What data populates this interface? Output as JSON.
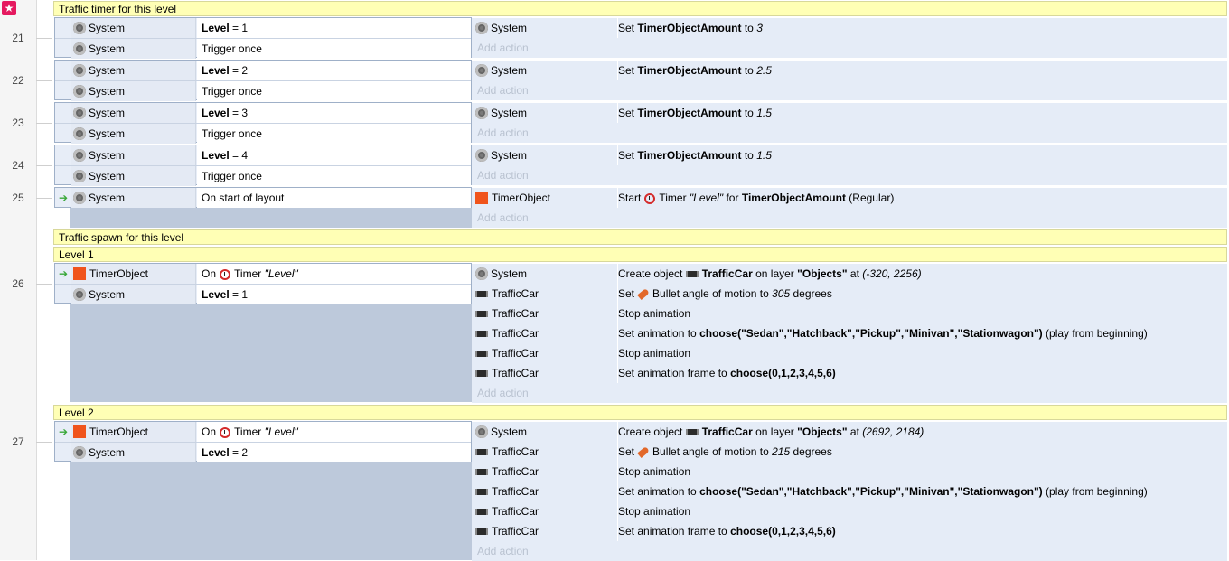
{
  "comments": {
    "traffic_timer": "Traffic timer for this level",
    "traffic_spawn": "Traffic spawn for this level",
    "level1": "Level 1",
    "level2": "Level 2"
  },
  "rownums": [
    "21",
    "22",
    "23",
    "24",
    "25",
    "26",
    "27"
  ],
  "common": {
    "system": "System",
    "timerobject": "TimerObject",
    "trafficcar": "TrafficCar",
    "trigger_once": "Trigger once",
    "add_action": "Add action",
    "level_kw": "Level",
    "eq": "= ",
    "on_start": "On start of layout",
    "on": "On",
    "timer": "Timer",
    "level_str": "\"Level\"",
    "set": "Set",
    "to": "to",
    "timer_amount": "TimerObjectAmount",
    "start": "Start",
    "for": "for",
    "regular": "(Regular)",
    "create_object": "Create object",
    "on_layer": "on layer",
    "objects_layer": "\"Objects\"",
    "at": "at",
    "bullet_angle": "Bullet angle of motion to",
    "degrees": "degrees",
    "stop_animation": "Stop animation",
    "set_anim_to": "Set animation to",
    "anim_choose": "choose(\"Sedan\",\"Hatchback\",\"Pickup\",\"Minivan\",\"Stationwagon\")",
    "play_beginning": "(play from beginning)",
    "set_frame_to": "Set animation frame to",
    "frame_choose": "choose(0,1,2,3,4,5,6)"
  },
  "events": {
    "e21": {
      "level": "1",
      "amount": "3"
    },
    "e22": {
      "level": "2",
      "amount": "2.5"
    },
    "e23": {
      "level": "3",
      "amount": "1.5"
    },
    "e24": {
      "level": "4",
      "amount": "1.5"
    },
    "e26": {
      "level": "1",
      "coords": "(-320, 2256)",
      "angle": "305"
    },
    "e27": {
      "level": "2",
      "coords": "(2692, 2184)",
      "angle": "215"
    }
  }
}
